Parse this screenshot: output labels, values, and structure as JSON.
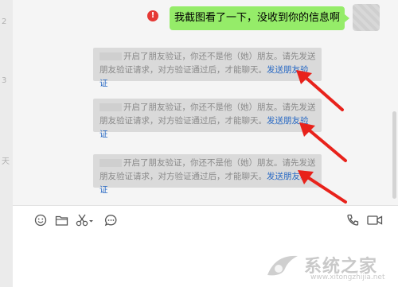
{
  "sidebar": {
    "edge_chars": [
      "2",
      "3",
      "",
      "天",
      "",
      ""
    ]
  },
  "messages": {
    "outgoing": {
      "text": "我截图看了一下，没收到你的信息啊"
    },
    "system": [
      {
        "line1": "开启了朋友验证，你还不是他（她）朋友。请先发送",
        "line2": "朋友验证请求，对方验证通过后，才能聊天。",
        "link": "发送朋友验",
        "link_tail": "证"
      },
      {
        "line1": "开启了朋友验证，你还不是他（她）朋友。请先发送",
        "line2": "朋友验证请求，对方验证通过后，才能聊天。",
        "link": "发送朋友验",
        "link_tail": "证"
      },
      {
        "line1": "开启了朋友验证，你还不是他（她）朋友。请先发送",
        "line2": "朋友验证请求，对方验证通过后，才能聊天。",
        "link": "发送朋友验",
        "link_tail": "证"
      }
    ]
  },
  "toolbar": {
    "left_icons": [
      "emoji-icon",
      "folder-icon",
      "scissors-icon",
      "chat-history-icon"
    ],
    "right_icons": [
      "phone-icon",
      "video-icon"
    ]
  },
  "watermark": {
    "name": "系统之家",
    "url": "www.xitongzhijia.net"
  },
  "colors": {
    "bubble_green": "#95ec69",
    "link_blue": "#2a6ac4",
    "arrow_red": "#e8221b"
  }
}
